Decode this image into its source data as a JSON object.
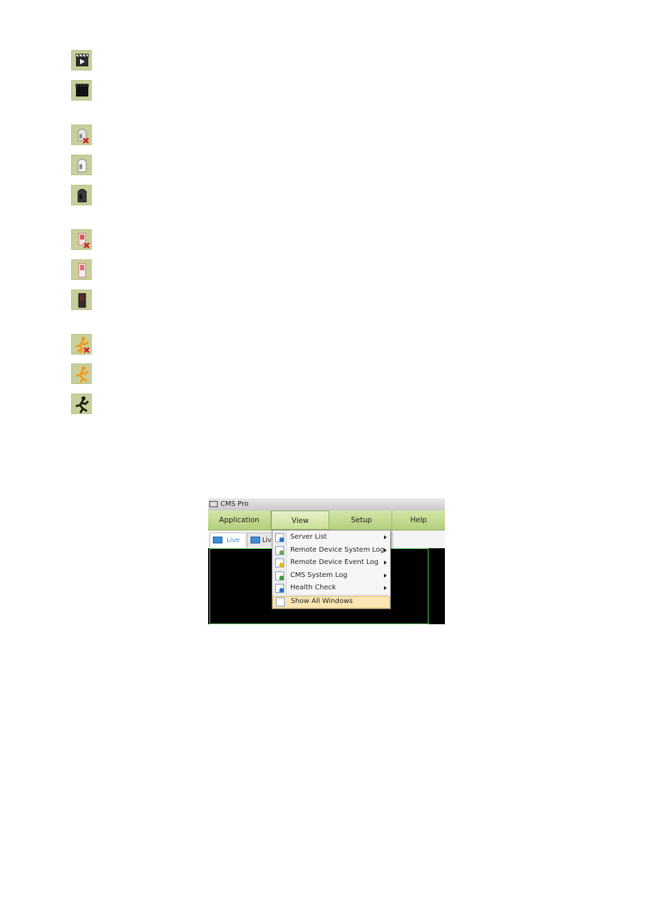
{
  "icons": [
    {
      "name": "clapperboard-play-icon"
    },
    {
      "name": "clapperboard-dark-icon"
    },
    {
      "name": "camera-disconnected-icon"
    },
    {
      "name": "camera-connected-icon"
    },
    {
      "name": "camera-dark-icon"
    },
    {
      "name": "sensor-disconnected-icon"
    },
    {
      "name": "sensor-connected-icon"
    },
    {
      "name": "sensor-dark-icon"
    },
    {
      "name": "motion-disconnected-icon"
    },
    {
      "name": "motion-active-icon"
    },
    {
      "name": "motion-dark-icon"
    }
  ],
  "window": {
    "title": "CMS Pro",
    "menu": [
      "Application",
      "View",
      "Setup",
      "Help"
    ],
    "tabs": [
      "Live 1",
      "Liv"
    ],
    "colors": {
      "menu": "#c3d98f",
      "video_border": "#5fd35f",
      "highlight": "#fbe6b4"
    }
  },
  "view_menu": {
    "items": [
      {
        "label": "Server List",
        "submenu": true,
        "icon": "info-window-icon"
      },
      {
        "label": "Remote Device System Log",
        "submenu": true,
        "icon": "log-window-icon"
      },
      {
        "label": "Remote Device Event Log",
        "submenu": true,
        "icon": "warning-window-icon"
      },
      {
        "label": "CMS System Log",
        "submenu": true,
        "icon": "check-window-icon"
      },
      {
        "label": "Health Check",
        "submenu": true,
        "icon": "info-window-icon"
      }
    ],
    "show_all": "Show All Windows"
  }
}
